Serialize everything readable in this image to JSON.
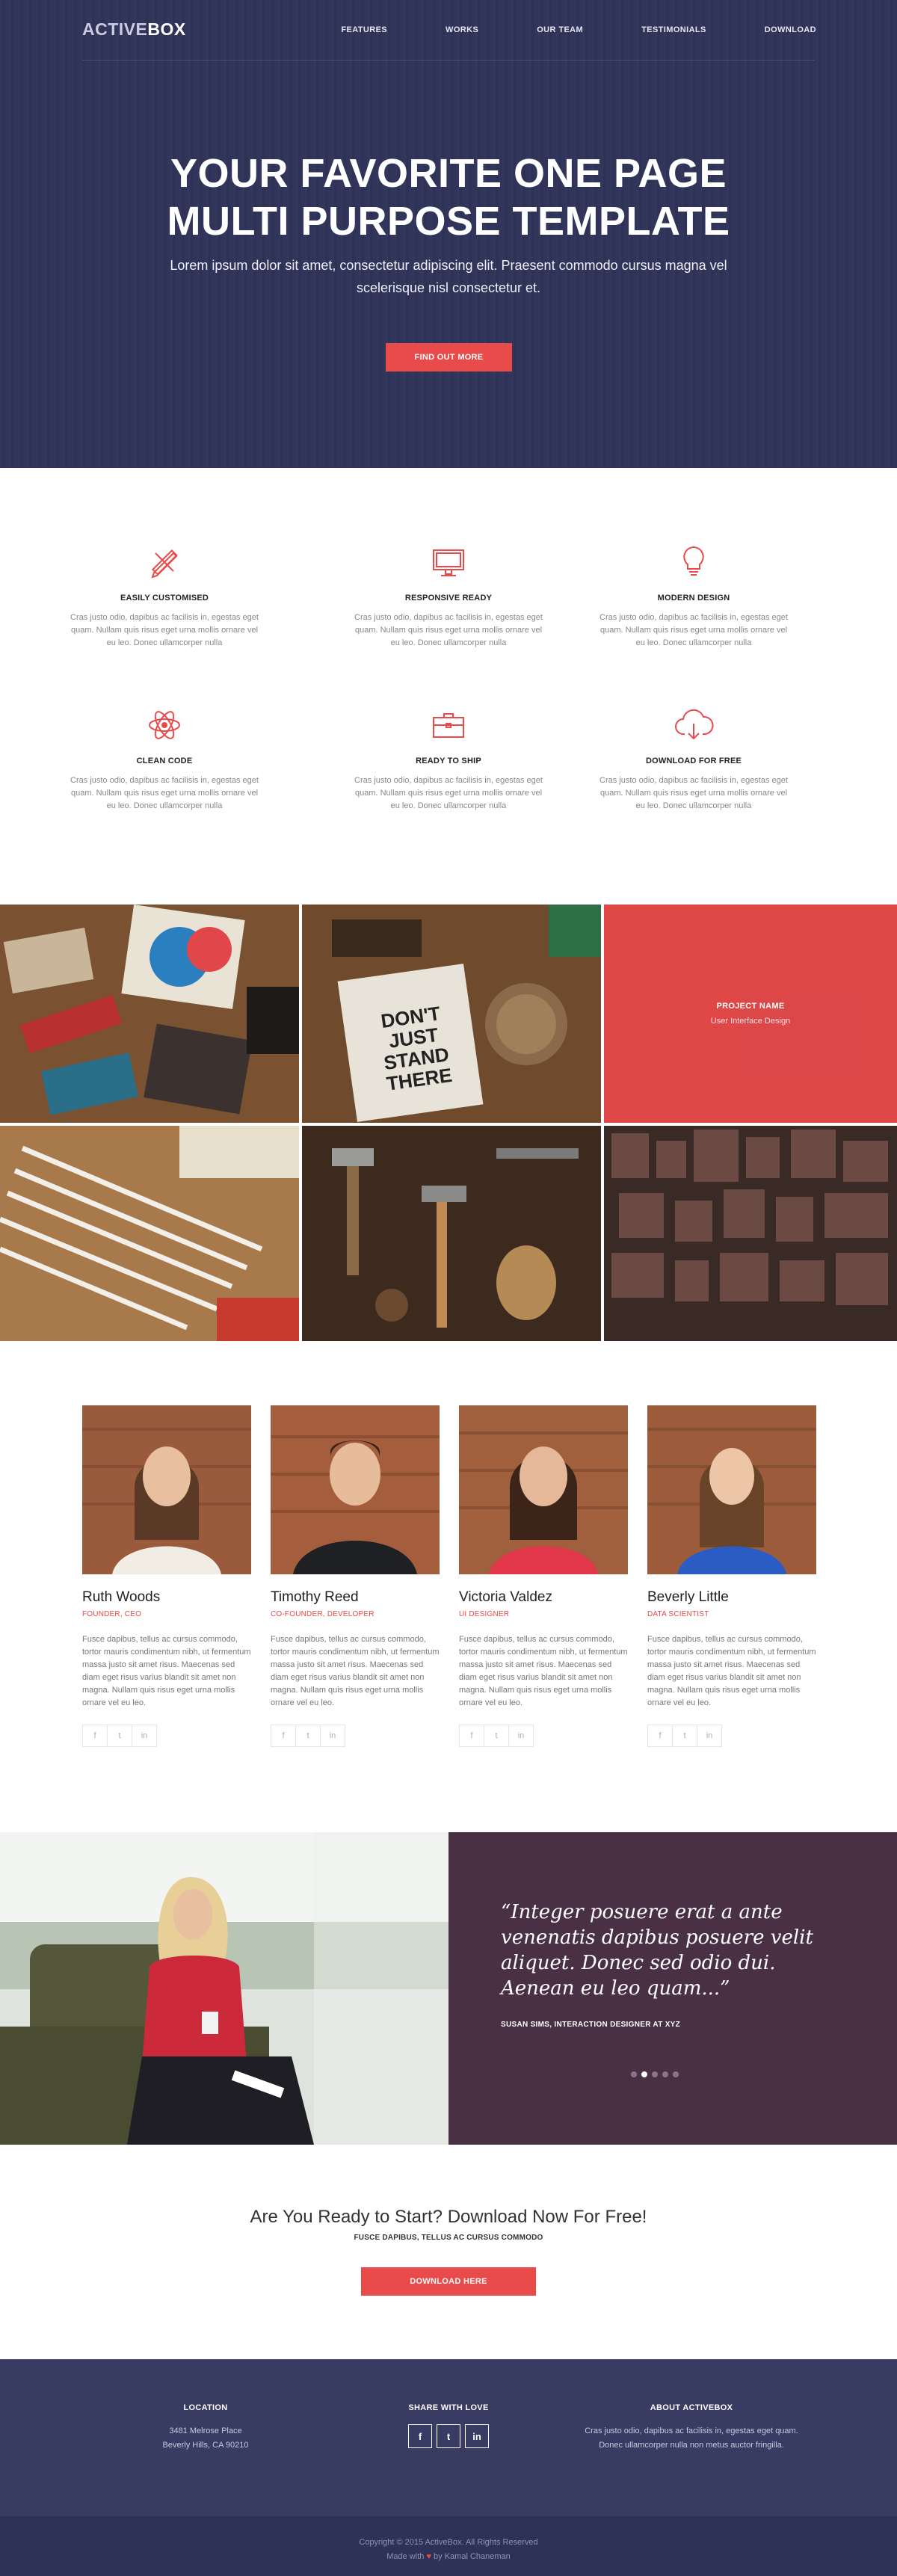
{
  "brand": {
    "part1": "ACTIVE",
    "part2": "BOX"
  },
  "nav": [
    "FEATURES",
    "WORKS",
    "OUR TEAM",
    "TESTIMONIALS",
    "DOWNLOAD"
  ],
  "hero": {
    "title_line1": "YOUR FAVORITE ONE PAGE",
    "title_line2": "MULTI PURPOSE TEMPLATE",
    "subtitle": "Lorem ipsum dolor sit amet, consectetur adipiscing elit. Praesent commodo cursus magna vel scelerisque nisl consectetur et.",
    "button": "FIND OUT MORE"
  },
  "features": [
    {
      "icon": "pencil-ruler-icon",
      "title": "EASILY CUSTOMISED",
      "text": "Cras justo odio, dapibus ac facilisis in, egestas eget quam. Nullam quis risus eget urna mollis ornare vel eu leo. Donec ullamcorper nulla"
    },
    {
      "icon": "monitor-icon",
      "title": "RESPONSIVE READY",
      "text": "Cras justo odio, dapibus ac facilisis in, egestas eget quam. Nullam quis risus eget urna mollis ornare vel eu leo. Donec ullamcorper nulla"
    },
    {
      "icon": "lightbulb-icon",
      "title": "MODERN DESIGN",
      "text": "Cras justo odio, dapibus ac facilisis in, egestas eget quam. Nullam quis risus eget urna mollis ornare vel eu leo. Donec ullamcorper nulla"
    },
    {
      "icon": "atom-icon",
      "title": "CLEAN CODE",
      "text": "Cras justo odio, dapibus ac facilisis in, egestas eget quam. Nullam quis risus eget urna mollis ornare vel eu leo. Donec ullamcorper nulla"
    },
    {
      "icon": "briefcase-icon",
      "title": "READY TO SHIP",
      "text": "Cras justo odio, dapibus ac facilisis in, egestas eget quam. Nullam quis risus eget urna mollis ornare vel eu leo. Donec ullamcorper nulla"
    },
    {
      "icon": "cloud-download-icon",
      "title": "DOWNLOAD FOR FREE",
      "text": "Cras justo odio, dapibus ac facilisis in, egestas eget quam. Nullam quis risus eget urna mollis ornare vel eu leo. Donec ullamcorper nulla"
    }
  ],
  "portfolio": {
    "overlay_title": "PROJECT NAME",
    "overlay_subtitle": "User Interface Design",
    "tile3_text_line1": "DON'T",
    "tile3_text_line2": "JUST",
    "tile3_text_line3": "STAND",
    "tile3_text_line4": "THERE"
  },
  "team": [
    {
      "name": "Ruth Woods",
      "role": "FOUNDER, CEO",
      "bio": "Fusce dapibus, tellus ac cursus commodo, tortor mauris condimentum nibh, ut fermentum massa justo sit amet risus. Maecenas sed diam eget risus varius blandit sit amet non magna. Nullam quis risus eget urna mollis ornare vel eu leo."
    },
    {
      "name": "Timothy Reed",
      "role": "CO-FOUNDER, DEVELOPER",
      "bio": "Fusce dapibus, tellus ac cursus commodo, tortor mauris condimentum nibh, ut fermentum massa justo sit amet risus. Maecenas sed diam eget risus varius blandit sit amet non magna. Nullam quis risus eget urna mollis ornare vel eu leo."
    },
    {
      "name": "Victoria Valdez",
      "role": "UI DESIGNER",
      "bio": "Fusce dapibus, tellus ac cursus commodo, tortor mauris condimentum nibh, ut fermentum massa justo sit amet risus. Maecenas sed diam eget risus varius blandit sit amet non magna. Nullam quis risus eget urna mollis ornare vel eu leo."
    },
    {
      "name": "Beverly Little",
      "role": "DATA SCIENTIST",
      "bio": "Fusce dapibus, tellus ac cursus commodo, tortor mauris condimentum nibh, ut fermentum massa justo sit amet risus. Maecenas sed diam eget risus varius blandit sit amet non magna. Nullam quis risus eget urna mollis ornare vel eu leo."
    }
  ],
  "social_glyphs": {
    "facebook": "f",
    "twitter": "t",
    "linkedin": "in"
  },
  "testimonial": {
    "quote": "“Integer posuere erat a ante venenatis dapibus posuere velit aliquet. Donec sed odio dui. Aenean eu leo quam...”",
    "author": "SUSAN SIMS, INTERACTION DESIGNER AT XYZ",
    "active_dot": 2,
    "dot_count": 5
  },
  "cta": {
    "title": "Are You Ready to Start? Download Now For Free!",
    "subtitle": "FUSCE DAPIBUS, TELLUS AC CURSUS COMMODO",
    "button": "DOWNLOAD HERE"
  },
  "footer": {
    "location_title": "LOCATION",
    "address_line1": "3481 Melrose Place",
    "address_line2": "Beverly Hills, CA 90210",
    "share_title": "SHARE WITH LOVE",
    "about_title": "ABOUT ACTIVEBOX",
    "about_text": "Cras justo odio, dapibus ac facilisis in, egestas eget quam. Donec ullamcorper nulla non metus auctor fringilla.",
    "copyright": "Copyright © 2015 ActiveBox. All Rights Reserved",
    "made_with": "Made with",
    "made_by": "by Kamal Chaneman"
  },
  "colors": {
    "accent": "#e94a4a",
    "hero_bg": "#2f3358",
    "testimonial_bg": "#4a3044",
    "footer_bg": "#383b62"
  }
}
